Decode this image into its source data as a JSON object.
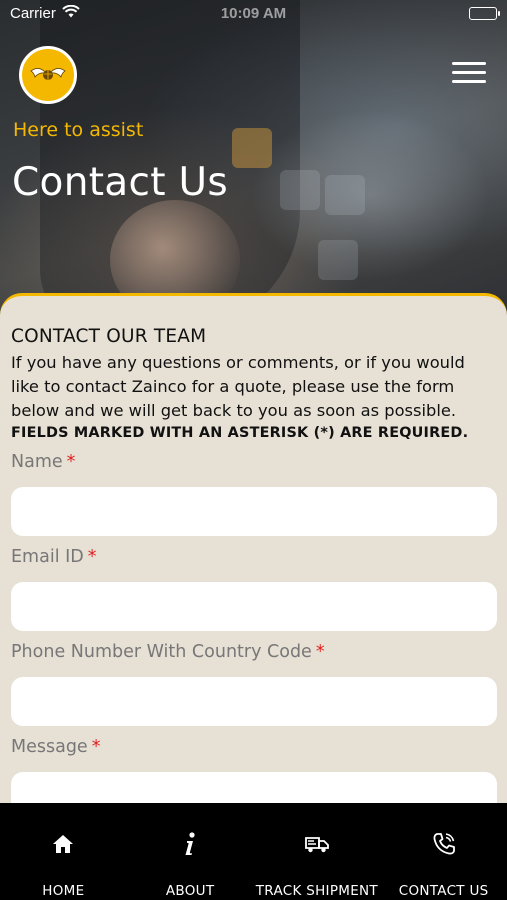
{
  "status_bar": {
    "carrier": "Carrier",
    "time": "10:09 AM"
  },
  "header": {
    "logo_icon": "winged-globe-logo",
    "menu_icon": "hamburger-menu-icon",
    "tagline": "Here to assist",
    "title": "Contact Us"
  },
  "form": {
    "section_title": "CONTACT OUR TEAM",
    "intro": "If you have any questions or comments, or if you would like to contact Zainco for a quote, please use the form below and we will get back to you as soon as possible.",
    "required_note": "FIELDS MARKED WITH AN ASTERISK (*) ARE REQUIRED.",
    "fields": [
      {
        "label": "Name",
        "required_mark": "*",
        "value": ""
      },
      {
        "label": "Email ID",
        "required_mark": "*",
        "value": ""
      },
      {
        "label": "Phone Number With Country Code",
        "required_mark": "*",
        "value": ""
      },
      {
        "label": "Message",
        "required_mark": "*",
        "value": ""
      }
    ]
  },
  "tabbar": {
    "items": [
      {
        "label": "HOME",
        "icon": "home-icon"
      },
      {
        "label": "ABOUT",
        "icon": "info-icon"
      },
      {
        "label": "TRACK SHIPMENT",
        "icon": "truck-icon"
      },
      {
        "label": "CONTACT US",
        "icon": "phone-icon"
      }
    ]
  },
  "colors": {
    "accent": "#f5b800",
    "card_background": "#e7e1d5",
    "required": "#e02020",
    "tabbar_background": "#000000"
  }
}
